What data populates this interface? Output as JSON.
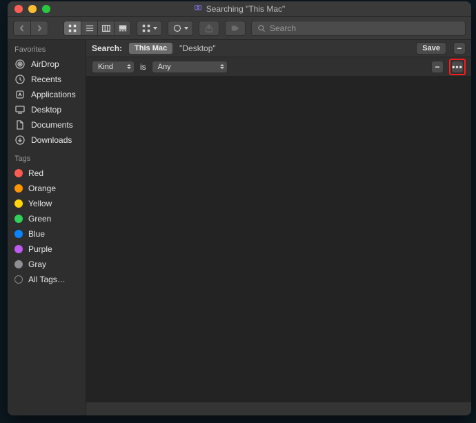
{
  "window": {
    "title": "Searching \"This Mac\""
  },
  "toolbar": {
    "search_placeholder": "Search"
  },
  "sidebar": {
    "favorites_header": "Favorites",
    "favorites": [
      {
        "label": "AirDrop"
      },
      {
        "label": "Recents"
      },
      {
        "label": "Applications"
      },
      {
        "label": "Desktop"
      },
      {
        "label": "Documents"
      },
      {
        "label": "Downloads"
      }
    ],
    "tags_header": "Tags",
    "tags": [
      {
        "label": "Red",
        "color": "#ff5b52"
      },
      {
        "label": "Orange",
        "color": "#ff9500"
      },
      {
        "label": "Yellow",
        "color": "#ffd60a"
      },
      {
        "label": "Green",
        "color": "#30d158"
      },
      {
        "label": "Blue",
        "color": "#0a84ff"
      },
      {
        "label": "Purple",
        "color": "#bf5af2"
      },
      {
        "label": "Gray",
        "color": "#8e8e93"
      }
    ],
    "all_tags_label": "All Tags…"
  },
  "search": {
    "label": "Search:",
    "scope_primary": "This Mac",
    "scope_secondary": "\"Desktop\"",
    "save_label": "Save"
  },
  "criteria": {
    "attribute": "Kind",
    "operator": "is",
    "value": "Any"
  }
}
